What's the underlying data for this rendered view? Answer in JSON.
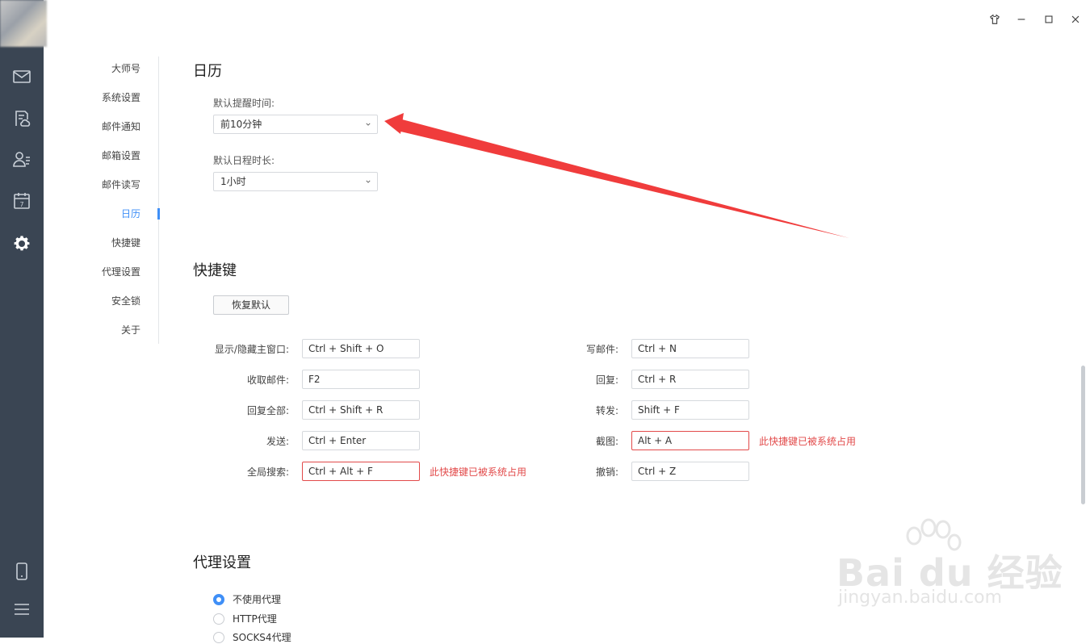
{
  "window_controls": {
    "skin_icon": "tshirt-icon",
    "minimize_icon": "minimize-icon",
    "maximize_icon": "maximize-icon",
    "close_icon": "close-icon"
  },
  "rail": {
    "icons": [
      "mail-icon",
      "notes-cloud-icon",
      "contacts-icon",
      "calendar-icon",
      "gear-icon",
      "phone-icon",
      "menu-icon"
    ],
    "calendar_day": "7"
  },
  "nav": {
    "items": [
      {
        "label": "大师号"
      },
      {
        "label": "系统设置"
      },
      {
        "label": "邮件通知"
      },
      {
        "label": "邮箱设置"
      },
      {
        "label": "邮件读写"
      },
      {
        "label": "日历"
      },
      {
        "label": "快捷键"
      },
      {
        "label": "代理设置"
      },
      {
        "label": "安全锁"
      },
      {
        "label": "关于"
      }
    ],
    "active_index": 5
  },
  "calendar": {
    "title": "日历",
    "reminder_label": "默认提醒时间:",
    "reminder_value": "前10分钟",
    "duration_label": "默认日程时长:",
    "duration_value": "1小时"
  },
  "shortcuts": {
    "title": "快捷键",
    "restore_button": "恢复默认",
    "conflict_message": "此快捷键已被系统占用",
    "left": [
      {
        "label": "显示/隐藏主窗口:",
        "value": "Ctrl + Shift + O",
        "error": false
      },
      {
        "label": "收取邮件:",
        "value": "F2",
        "error": false
      },
      {
        "label": "回复全部:",
        "value": "Ctrl + Shift + R",
        "error": false
      },
      {
        "label": "发送:",
        "value": "Ctrl + Enter",
        "error": false
      },
      {
        "label": "全局搜索:",
        "value": "Ctrl + Alt + F",
        "error": true
      }
    ],
    "right": [
      {
        "label": "写邮件:",
        "value": "Ctrl + N",
        "error": false
      },
      {
        "label": "回复:",
        "value": "Ctrl + R",
        "error": false
      },
      {
        "label": "转发:",
        "value": "Shift + F",
        "error": false
      },
      {
        "label": "截图:",
        "value": "Alt + A",
        "error": true
      },
      {
        "label": "撤销:",
        "value": "Ctrl + Z",
        "error": false
      }
    ]
  },
  "proxy": {
    "title": "代理设置",
    "options": [
      {
        "label": "不使用代理",
        "checked": true
      },
      {
        "label": "HTTP代理",
        "checked": false
      },
      {
        "label": "SOCKS4代理",
        "checked": false
      }
    ]
  },
  "watermark": {
    "brand": "Bai du 经验",
    "url": "jingyan.baidu.com"
  },
  "colors": {
    "accent": "#3f8ff7",
    "error": "#e24a4a",
    "rail": "#3a4553",
    "annotation_arrow": "#f03c3c"
  }
}
